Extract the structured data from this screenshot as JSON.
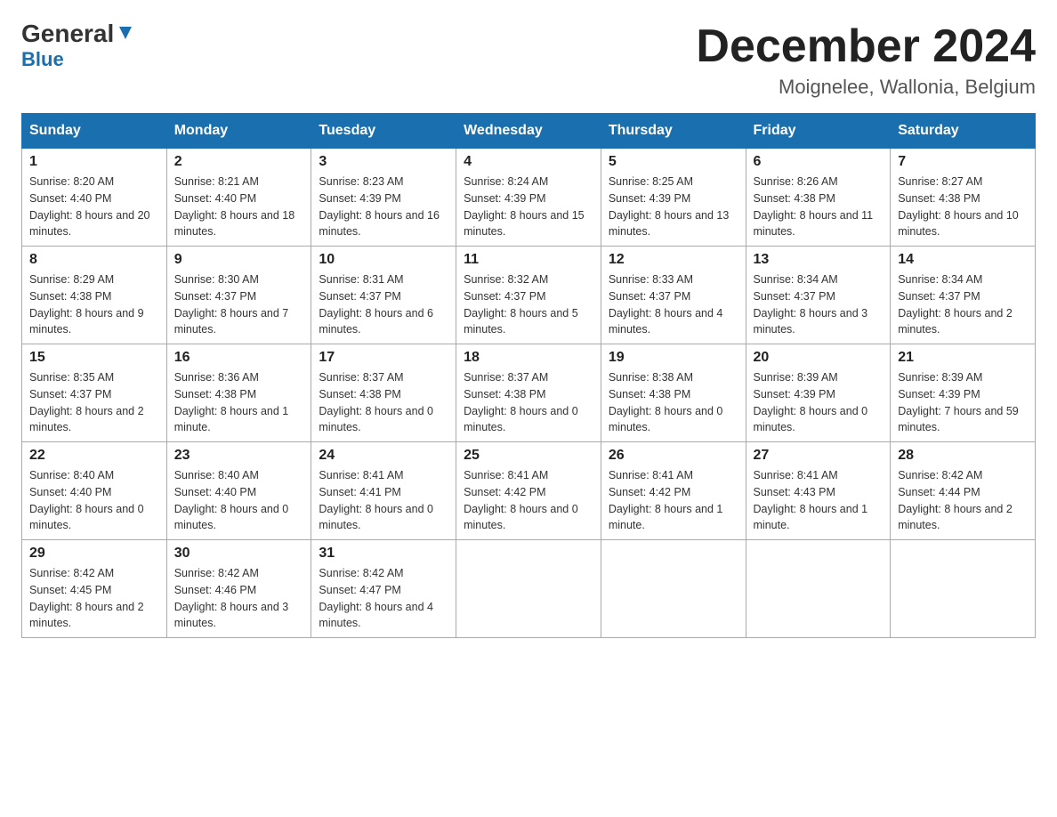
{
  "header": {
    "logo_general": "General",
    "logo_blue": "Blue",
    "month_title": "December 2024",
    "location": "Moignelee, Wallonia, Belgium"
  },
  "days_of_week": [
    "Sunday",
    "Monday",
    "Tuesday",
    "Wednesday",
    "Thursday",
    "Friday",
    "Saturday"
  ],
  "weeks": [
    [
      {
        "day": "1",
        "sunrise": "8:20 AM",
        "sunset": "4:40 PM",
        "daylight": "8 hours and 20 minutes."
      },
      {
        "day": "2",
        "sunrise": "8:21 AM",
        "sunset": "4:40 PM",
        "daylight": "8 hours and 18 minutes."
      },
      {
        "day": "3",
        "sunrise": "8:23 AM",
        "sunset": "4:39 PM",
        "daylight": "8 hours and 16 minutes."
      },
      {
        "day": "4",
        "sunrise": "8:24 AM",
        "sunset": "4:39 PM",
        "daylight": "8 hours and 15 minutes."
      },
      {
        "day": "5",
        "sunrise": "8:25 AM",
        "sunset": "4:39 PM",
        "daylight": "8 hours and 13 minutes."
      },
      {
        "day": "6",
        "sunrise": "8:26 AM",
        "sunset": "4:38 PM",
        "daylight": "8 hours and 11 minutes."
      },
      {
        "day": "7",
        "sunrise": "8:27 AM",
        "sunset": "4:38 PM",
        "daylight": "8 hours and 10 minutes."
      }
    ],
    [
      {
        "day": "8",
        "sunrise": "8:29 AM",
        "sunset": "4:38 PM",
        "daylight": "8 hours and 9 minutes."
      },
      {
        "day": "9",
        "sunrise": "8:30 AM",
        "sunset": "4:37 PM",
        "daylight": "8 hours and 7 minutes."
      },
      {
        "day": "10",
        "sunrise": "8:31 AM",
        "sunset": "4:37 PM",
        "daylight": "8 hours and 6 minutes."
      },
      {
        "day": "11",
        "sunrise": "8:32 AM",
        "sunset": "4:37 PM",
        "daylight": "8 hours and 5 minutes."
      },
      {
        "day": "12",
        "sunrise": "8:33 AM",
        "sunset": "4:37 PM",
        "daylight": "8 hours and 4 minutes."
      },
      {
        "day": "13",
        "sunrise": "8:34 AM",
        "sunset": "4:37 PM",
        "daylight": "8 hours and 3 minutes."
      },
      {
        "day": "14",
        "sunrise": "8:34 AM",
        "sunset": "4:37 PM",
        "daylight": "8 hours and 2 minutes."
      }
    ],
    [
      {
        "day": "15",
        "sunrise": "8:35 AM",
        "sunset": "4:37 PM",
        "daylight": "8 hours and 2 minutes."
      },
      {
        "day": "16",
        "sunrise": "8:36 AM",
        "sunset": "4:38 PM",
        "daylight": "8 hours and 1 minute."
      },
      {
        "day": "17",
        "sunrise": "8:37 AM",
        "sunset": "4:38 PM",
        "daylight": "8 hours and 0 minutes."
      },
      {
        "day": "18",
        "sunrise": "8:37 AM",
        "sunset": "4:38 PM",
        "daylight": "8 hours and 0 minutes."
      },
      {
        "day": "19",
        "sunrise": "8:38 AM",
        "sunset": "4:38 PM",
        "daylight": "8 hours and 0 minutes."
      },
      {
        "day": "20",
        "sunrise": "8:39 AM",
        "sunset": "4:39 PM",
        "daylight": "8 hours and 0 minutes."
      },
      {
        "day": "21",
        "sunrise": "8:39 AM",
        "sunset": "4:39 PM",
        "daylight": "7 hours and 59 minutes."
      }
    ],
    [
      {
        "day": "22",
        "sunrise": "8:40 AM",
        "sunset": "4:40 PM",
        "daylight": "8 hours and 0 minutes."
      },
      {
        "day": "23",
        "sunrise": "8:40 AM",
        "sunset": "4:40 PM",
        "daylight": "8 hours and 0 minutes."
      },
      {
        "day": "24",
        "sunrise": "8:41 AM",
        "sunset": "4:41 PM",
        "daylight": "8 hours and 0 minutes."
      },
      {
        "day": "25",
        "sunrise": "8:41 AM",
        "sunset": "4:42 PM",
        "daylight": "8 hours and 0 minutes."
      },
      {
        "day": "26",
        "sunrise": "8:41 AM",
        "sunset": "4:42 PM",
        "daylight": "8 hours and 1 minute."
      },
      {
        "day": "27",
        "sunrise": "8:41 AM",
        "sunset": "4:43 PM",
        "daylight": "8 hours and 1 minute."
      },
      {
        "day": "28",
        "sunrise": "8:42 AM",
        "sunset": "4:44 PM",
        "daylight": "8 hours and 2 minutes."
      }
    ],
    [
      {
        "day": "29",
        "sunrise": "8:42 AM",
        "sunset": "4:45 PM",
        "daylight": "8 hours and 2 minutes."
      },
      {
        "day": "30",
        "sunrise": "8:42 AM",
        "sunset": "4:46 PM",
        "daylight": "8 hours and 3 minutes."
      },
      {
        "day": "31",
        "sunrise": "8:42 AM",
        "sunset": "4:47 PM",
        "daylight": "8 hours and 4 minutes."
      },
      null,
      null,
      null,
      null
    ]
  ],
  "labels": {
    "sunrise": "Sunrise:",
    "sunset": "Sunset:",
    "daylight": "Daylight:"
  }
}
